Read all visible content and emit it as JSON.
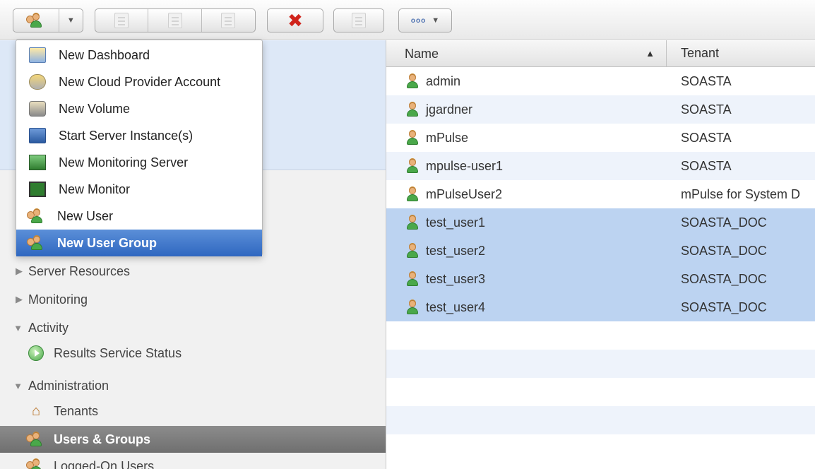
{
  "toolbar": {
    "new_button_icon": "new-user-group-icon",
    "view_menu_icon": "dots-icon",
    "delete_icon": "red-x-icon"
  },
  "menu": {
    "items": [
      {
        "label": "New Dashboard",
        "icon": "dashboard-icon"
      },
      {
        "label": "New Cloud Provider Account",
        "icon": "cloud-icon"
      },
      {
        "label": "New Volume",
        "icon": "volume-icon"
      },
      {
        "label": "Start Server Instance(s)",
        "icon": "server-start-icon"
      },
      {
        "label": "New Monitoring Server",
        "icon": "monitoring-server-icon"
      },
      {
        "label": "New Monitor",
        "icon": "monitor-icon"
      },
      {
        "label": "New User",
        "icon": "user-icon"
      },
      {
        "label": "New User Group",
        "icon": "user-group-icon"
      }
    ],
    "highlighted": "New User Group"
  },
  "nav": {
    "server_resources": "Server Resources",
    "monitoring": "Monitoring",
    "activity": "Activity",
    "results_service_status": "Results Service Status",
    "administration": "Administration",
    "tenants": "Tenants",
    "users_groups": "Users & Groups",
    "logged_on_users": "Logged-On Users"
  },
  "table": {
    "columns": {
      "name": "Name",
      "tenant": "Tenant"
    },
    "sort_indicator": "▲",
    "rows": [
      {
        "name": "admin",
        "tenant": "SOASTA",
        "selected": false
      },
      {
        "name": "jgardner",
        "tenant": "SOASTA",
        "selected": false
      },
      {
        "name": "mPulse",
        "tenant": "SOASTA",
        "selected": false
      },
      {
        "name": "mpulse-user1",
        "tenant": "SOASTA",
        "selected": false
      },
      {
        "name": "mPulseUser2",
        "tenant": "mPulse for System D",
        "selected": false
      },
      {
        "name": "test_user1",
        "tenant": "SOASTA_DOC",
        "selected": true
      },
      {
        "name": "test_user2",
        "tenant": "SOASTA_DOC",
        "selected": true
      },
      {
        "name": "test_user3",
        "tenant": "SOASTA_DOC",
        "selected": true
      },
      {
        "name": "test_user4",
        "tenant": "SOASTA_DOC",
        "selected": true
      }
    ]
  },
  "colors": {
    "selection": "#bcd3f1",
    "menu_highlight": "#2f67c0",
    "nav_selected": "#7a7a7a"
  }
}
